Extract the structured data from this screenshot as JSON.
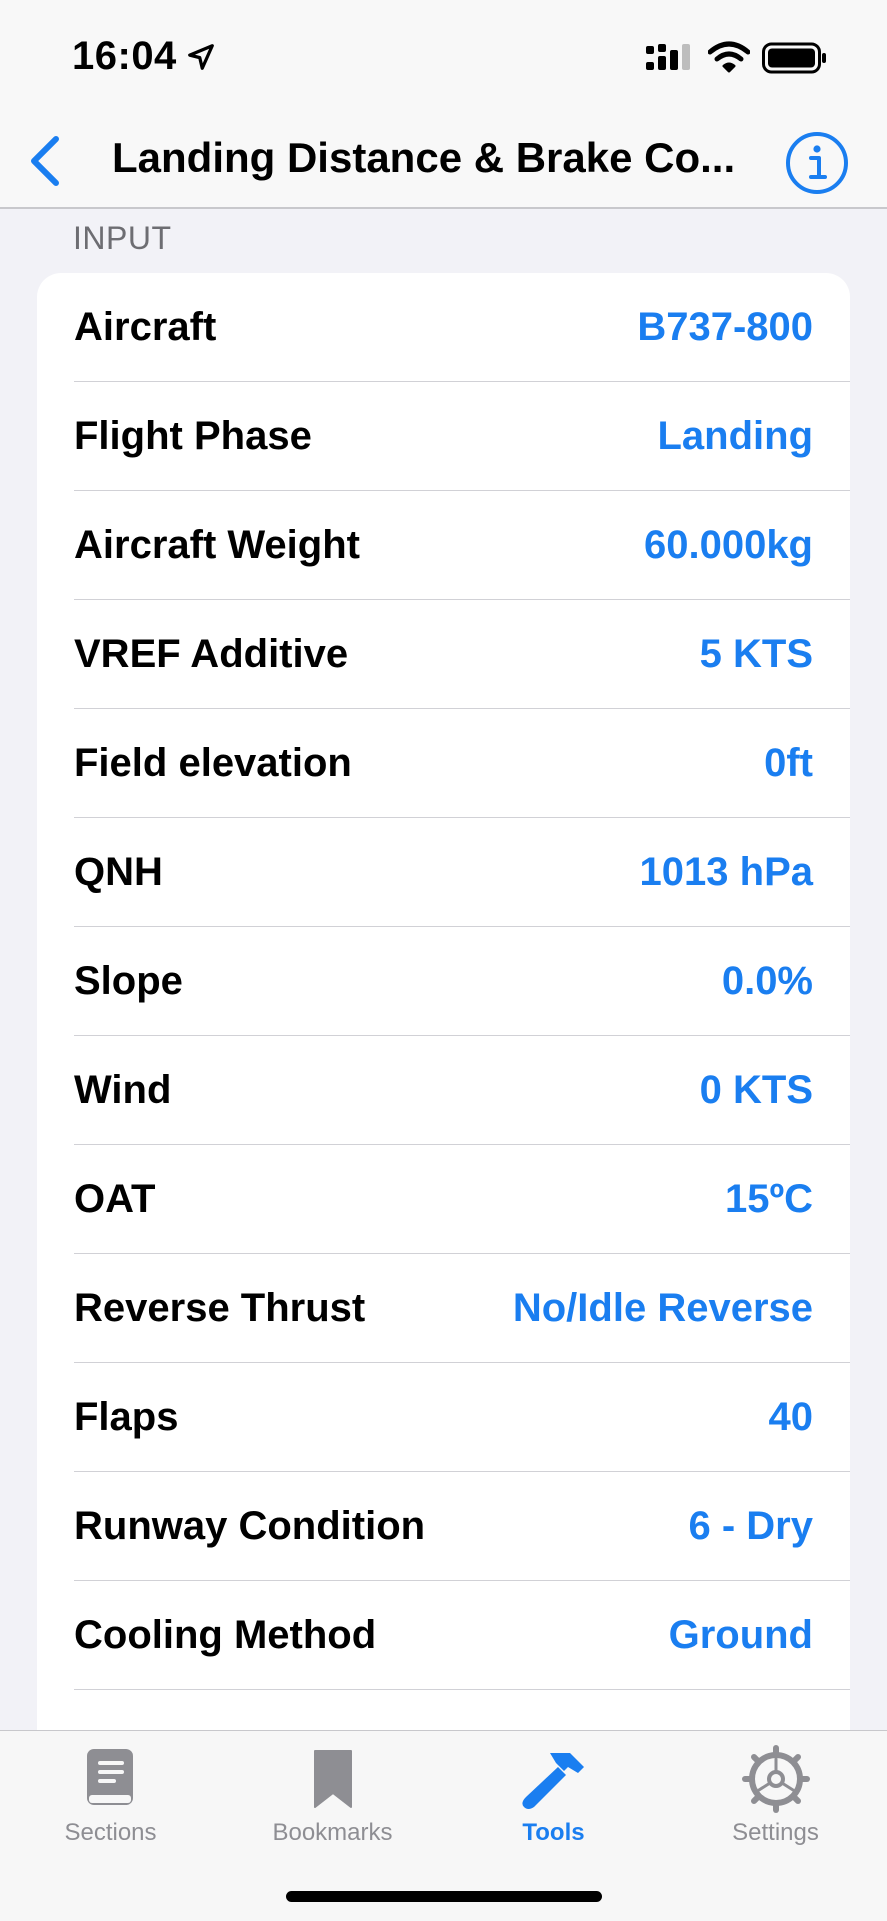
{
  "status_bar": {
    "time": "16:04"
  },
  "nav": {
    "title": "Landing Distance & Brake Co..."
  },
  "section": {
    "header": "INPUT"
  },
  "rows": [
    {
      "label": "Aircraft",
      "value": "B737-800"
    },
    {
      "label": "Flight Phase",
      "value": "Landing"
    },
    {
      "label": "Aircraft Weight",
      "value": "60.000kg"
    },
    {
      "label": "VREF Additive",
      "value": "5 KTS"
    },
    {
      "label": "Field elevation",
      "value": "0ft"
    },
    {
      "label": "QNH",
      "value": "1013 hPa"
    },
    {
      "label": "Slope",
      "value": "0.0%"
    },
    {
      "label": "Wind",
      "value": "0 KTS"
    },
    {
      "label": "OAT",
      "value": "15ºC"
    },
    {
      "label": "Reverse Thrust",
      "value": "No/Idle Reverse"
    },
    {
      "label": "Flaps",
      "value": "40"
    },
    {
      "label": "Runway Condition",
      "value": "6 - Dry"
    },
    {
      "label": "Cooling Method",
      "value": "Ground"
    }
  ],
  "tabs": [
    {
      "label": "Sections",
      "icon": "book-icon",
      "active": false
    },
    {
      "label": "Bookmarks",
      "icon": "bookmark-icon",
      "active": false
    },
    {
      "label": "Tools",
      "icon": "hammer-icon",
      "active": true
    },
    {
      "label": "Settings",
      "icon": "gear-icon",
      "active": false
    }
  ],
  "colors": {
    "accent": "#1a7ef0",
    "background": "#f2f2f7",
    "inactive": "#8e8e93"
  }
}
